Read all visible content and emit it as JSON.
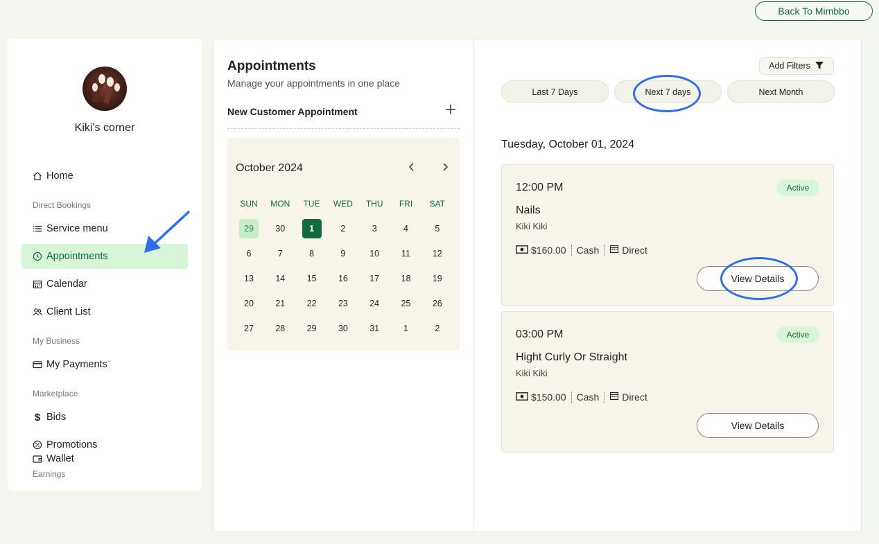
{
  "header": {
    "back_label": "Back To Mimbbo"
  },
  "sidebar": {
    "business_name": "Kiki's corner",
    "items": [
      {
        "label": "Home",
        "icon": "home-icon"
      },
      {
        "label": "Service menu",
        "icon": "list-icon"
      },
      {
        "label": "Appointments",
        "icon": "clock-icon"
      },
      {
        "label": "Calendar",
        "icon": "calendar-icon"
      },
      {
        "label": "Client List",
        "icon": "users-icon"
      },
      {
        "label": "My Payments",
        "icon": "card-icon"
      },
      {
        "label": "Bids",
        "icon": "dollar-icon"
      },
      {
        "label": "Promotions",
        "icon": "badge-icon"
      },
      {
        "label": "Wallet",
        "icon": "wallet-icon"
      }
    ],
    "sections": [
      "Direct Bookings",
      "My Business",
      "Marketplace",
      "Earnings"
    ]
  },
  "main": {
    "title": "Appointments",
    "subtitle": "Manage your appointments in one place",
    "new_appointment_label": "New Customer Appointment",
    "calendar": {
      "month_label": "October 2024",
      "weekdays": [
        "SUN",
        "MON",
        "TUE",
        "WED",
        "THU",
        "FRI",
        "SAT"
      ],
      "days": [
        "29",
        "30",
        "1",
        "2",
        "3",
        "4",
        "5",
        "6",
        "7",
        "8",
        "9",
        "10",
        "11",
        "12",
        "13",
        "14",
        "15",
        "16",
        "17",
        "18",
        "19",
        "20",
        "21",
        "22",
        "23",
        "24",
        "25",
        "26",
        "27",
        "28",
        "29",
        "30",
        "31",
        "1",
        "2"
      ]
    }
  },
  "right": {
    "filters_label": "Add Filters",
    "ranges": [
      "Last 7 Days",
      "Next 7 days",
      "Next Month"
    ],
    "date_heading": "Tuesday, October 01, 2024",
    "appointments": [
      {
        "time": "12:00 PM",
        "status": "Active",
        "service": "Nails",
        "client": "Kiki Kiki",
        "price": "$160.00",
        "payment": "Cash",
        "channel": "Direct",
        "action": "View Details"
      },
      {
        "time": "03:00 PM",
        "status": "Active",
        "service": "Hight Curly Or Straight",
        "client": "Kiki Kiki",
        "price": "$150.00",
        "payment": "Cash",
        "channel": "Direct",
        "action": "View Details"
      }
    ]
  },
  "colors": {
    "accent": "#0f6b3f",
    "active_bg": "#d6f5d9",
    "highlight": "#2f6ee6",
    "card_bg": "#f7f5e9"
  }
}
